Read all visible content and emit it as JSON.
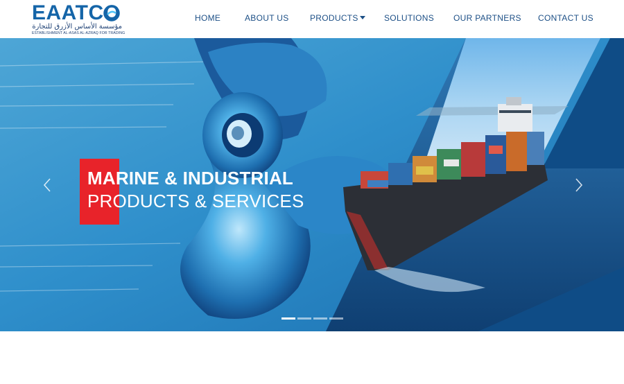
{
  "brand": {
    "logo_text": "EAATCO",
    "arabic_name": "مؤسسة الأساس الأزرق للتجارة",
    "english_name": "ESTABLISHMENT AL-ASAS AL-AZRAQ FOR TRADING",
    "brand_color": "#1565a8",
    "ring_color": "#1e88c9"
  },
  "nav": {
    "items": [
      {
        "label": "HOME"
      },
      {
        "label": "ABOUT US"
      },
      {
        "label": "PRODUCTS",
        "has_dropdown": true
      },
      {
        "label": "SOLUTIONS"
      },
      {
        "label": "OUR PARTNERS"
      },
      {
        "label": "CONTACT US"
      }
    ],
    "text_color": "#1c4f86"
  },
  "hero": {
    "headline_line1": "MARINE & INDUSTRIAL",
    "headline_line2": "PRODUCTS & SERVICES",
    "accent_color": "#e8232a",
    "panel_color": "#0f4c86",
    "slide_count": 4,
    "active_slide": 1,
    "prev_icon": "chevron-left-icon",
    "next_icon": "chevron-right-icon"
  }
}
